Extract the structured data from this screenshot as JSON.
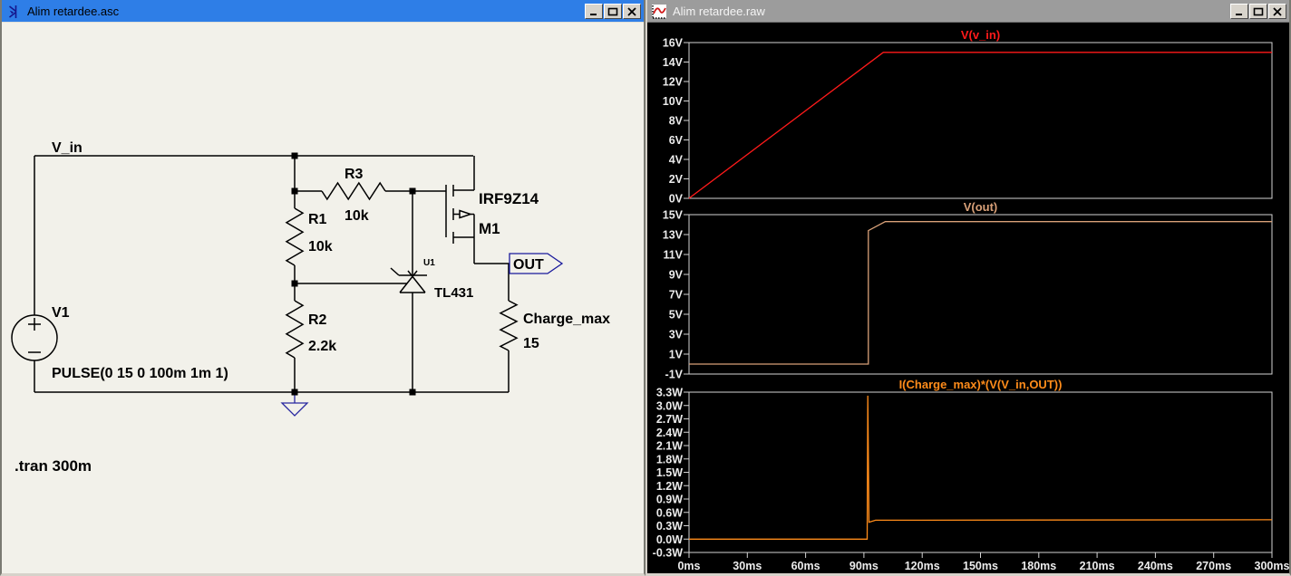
{
  "left_window": {
    "title": "Alim retardee.asc",
    "icon": "schematic-component-icon",
    "schematic": {
      "net_labels": {
        "vin": "V_in",
        "out": "OUT"
      },
      "components": {
        "v1": {
          "name": "V1",
          "value": "PULSE(0 15 0 100m 1m 1)"
        },
        "r1": {
          "name": "R1",
          "value": "10k"
        },
        "r2": {
          "name": "R2",
          "value": "2.2k"
        },
        "r3": {
          "name": "R3",
          "value": "10k"
        },
        "u1": {
          "name": "U1",
          "value": "TL431"
        },
        "m1": {
          "name": "M1",
          "value": "IRF9Z14"
        },
        "load": {
          "name": "Charge_max",
          "value": "15"
        }
      },
      "spice_directive": ".tran 300m"
    }
  },
  "right_window": {
    "title": "Alim retardee.raw",
    "icon": "waveform-icon",
    "xticks": [
      "0ms",
      "30ms",
      "60ms",
      "90ms",
      "120ms",
      "150ms",
      "180ms",
      "210ms",
      "240ms",
      "270ms",
      "300ms"
    ]
  },
  "chart_data": [
    {
      "type": "line",
      "title": "V(v_in)",
      "color": "#FF1A1A",
      "x": [
        0,
        100,
        300
      ],
      "values": [
        0,
        15,
        15
      ],
      "ylim": [
        0,
        16
      ],
      "xlim": [
        0,
        300
      ],
      "yticks": [
        "16V",
        "14V",
        "12V",
        "10V",
        "8V",
        "6V",
        "4V",
        "2V",
        "0V"
      ],
      "xlabel_unit": "ms",
      "grid": false,
      "legend": "title-above"
    },
    {
      "type": "line",
      "title": "V(out)",
      "color": "#D8A078",
      "x": [
        0,
        92.3,
        92.3,
        101,
        300
      ],
      "values": [
        0,
        0,
        13.4,
        14.3,
        14.3
      ],
      "ylim": [
        -1,
        15
      ],
      "xlim": [
        0,
        300
      ],
      "yticks": [
        "15V",
        "13V",
        "11V",
        "9V",
        "7V",
        "5V",
        "3V",
        "1V",
        "-1V"
      ],
      "xlabel_unit": "ms",
      "grid": false,
      "legend": "title-above"
    },
    {
      "type": "line",
      "title": "I(Charge_max)*(V(V_in,OUT))",
      "color": "#FF8C1A",
      "x": [
        0,
        91.7,
        92.0,
        92.6,
        96,
        300
      ],
      "values": [
        0,
        0,
        3.22,
        0.38,
        0.425,
        0.435
      ],
      "ylim": [
        -0.3,
        3.3
      ],
      "xlim": [
        0,
        300
      ],
      "yticks": [
        "3.3W",
        "3.0W",
        "2.7W",
        "2.4W",
        "2.1W",
        "1.8W",
        "1.5W",
        "1.2W",
        "0.9W",
        "0.6W",
        "0.3W",
        "0.0W",
        "-0.3W"
      ],
      "xlabel_unit": "ms",
      "grid": false,
      "legend": "title-above"
    }
  ]
}
